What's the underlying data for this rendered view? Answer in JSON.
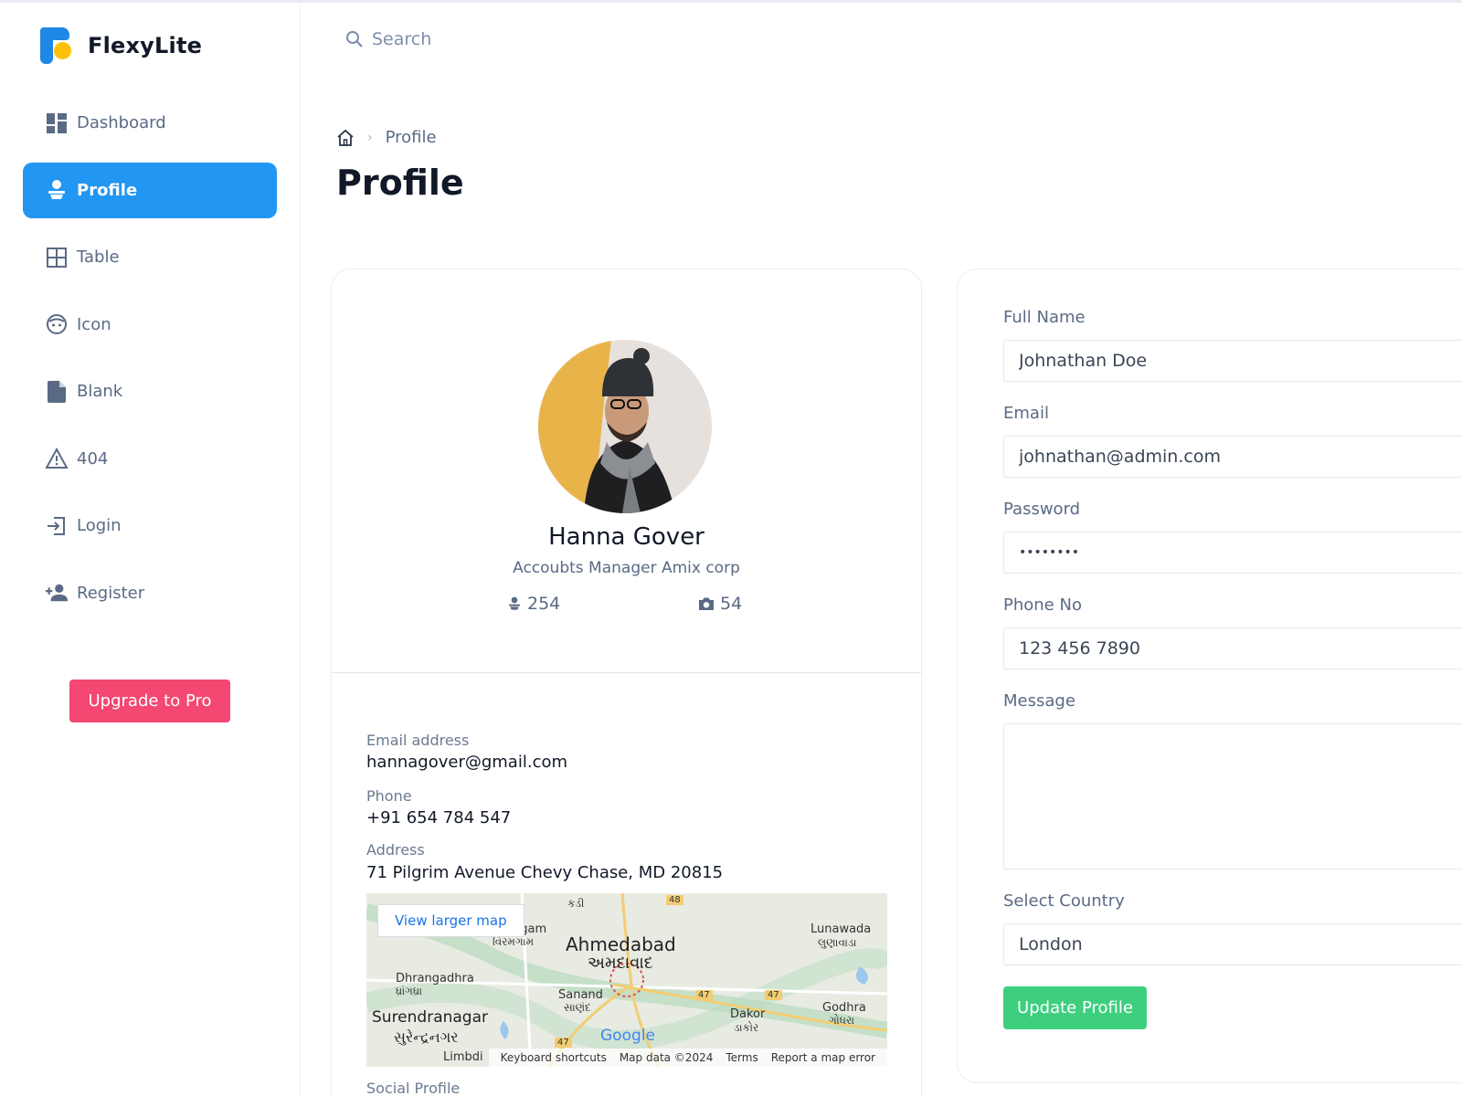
{
  "app": {
    "name": "FlexyLite"
  },
  "sidebar": {
    "items": [
      {
        "label": "Dashboard",
        "icon": "dashboard-icon"
      },
      {
        "label": "Profile",
        "icon": "profile-icon",
        "active": true
      },
      {
        "label": "Table",
        "icon": "table-icon"
      },
      {
        "label": "Icon",
        "icon": "face-icon"
      },
      {
        "label": "Blank",
        "icon": "file-icon"
      },
      {
        "label": "404",
        "icon": "warning-icon"
      },
      {
        "label": "Login",
        "icon": "login-icon"
      },
      {
        "label": "Register",
        "icon": "add-user-icon"
      }
    ],
    "upgrade_label": "Upgrade to Pro"
  },
  "search": {
    "placeholder": "Search"
  },
  "breadcrumb": {
    "current": "Profile"
  },
  "page": {
    "title": "Profile"
  },
  "profile": {
    "name": "Hanna Gover",
    "role": "Accoubts Manager Amix corp",
    "followers": "254",
    "photos": "54",
    "email_label": "Email address",
    "email": "hannagover@gmail.com",
    "phone_label": "Phone",
    "phone": "+91 654 784 547",
    "address_label": "Address",
    "address": "71 Pilgrim Avenue Chevy Chase, MD 20815",
    "social_label": "Social Profile"
  },
  "map": {
    "link_label": "View larger map",
    "places": [
      "Ahmedabad",
      "અમદાવાદ",
      "Surendranagar",
      "સુરેન્દ્રનગર",
      "Dhrangadhra",
      "ધ્રાંગધ્રા",
      "Sanand",
      "સાણંદ",
      "Lunawada",
      "લુણાવાડા",
      "Godhra",
      "ગોધરા",
      "Dakor",
      "ડાકોર",
      "Limbdi",
      "ngam",
      "વિરમગામ",
      "કડી"
    ],
    "road_numbers": [
      "48",
      "47",
      "47",
      "47"
    ],
    "logo": "Google",
    "footer": [
      "Keyboard shortcuts",
      "Map data ©2024",
      "Terms",
      "Report a map error"
    ]
  },
  "form": {
    "fullname_label": "Full Name",
    "fullname": "Johnathan Doe",
    "email_label": "Email",
    "email": "johnathan@admin.com",
    "password_label": "Password",
    "password": "••••••••",
    "phone_label": "Phone No",
    "phone": "123 456 7890",
    "message_label": "Message",
    "message": "",
    "country_label": "Select Country",
    "country": "London",
    "update_label": "Update Profile"
  },
  "colors": {
    "primary": "#2196f3",
    "upgrade": "#f44771",
    "success": "#3ecf7e",
    "logo_yellow": "#ffc107"
  }
}
